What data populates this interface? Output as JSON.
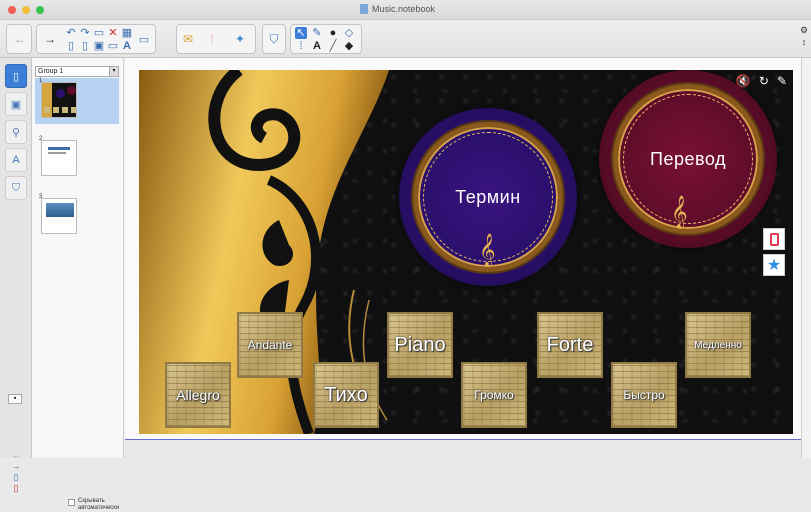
{
  "window": {
    "title": "Music.notebook"
  },
  "sorter": {
    "group_label": "Group 1",
    "pages": [
      {
        "number": "1"
      },
      {
        "number": "2"
      },
      {
        "number": "3"
      }
    ],
    "autohide_label_1": "Скрывать",
    "autohide_label_2": "автоматически"
  },
  "slide": {
    "term_label": "Термин",
    "translation_label": "Перевод",
    "cards": [
      {
        "label": "Allegro"
      },
      {
        "label": "Andante"
      },
      {
        "label": "Тихо"
      },
      {
        "label": "Piano"
      },
      {
        "label": "Громко"
      },
      {
        "label": "Forte"
      },
      {
        "label": "Быстро"
      },
      {
        "label": "Медленно"
      }
    ]
  },
  "icons": {
    "back": "back-arrow-icon",
    "forward": "forward-arrow-icon",
    "undo": "undo-icon",
    "redo": "redo-icon",
    "delete": "delete-icon",
    "table": "table-icon",
    "select": "select-icon",
    "pen": "pen-icon",
    "text": "text-icon",
    "line": "line-icon",
    "eraser": "eraser-icon",
    "settings": "gear-icon"
  },
  "colors": {
    "accent_blue": "#3d7fd6",
    "term_circle": "#2a0f6b",
    "translation_circle": "#5e0c2a",
    "gold": "#d9a34a"
  }
}
